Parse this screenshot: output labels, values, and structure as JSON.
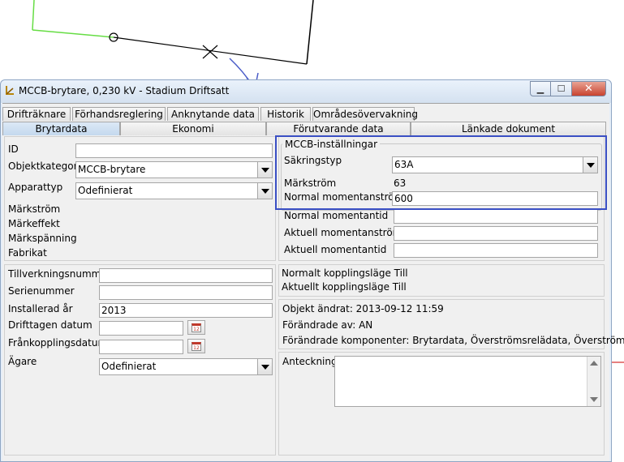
{
  "window": {
    "title": "MCCB-brytare, 0,230 kV - Stadium Driftsatt",
    "minimize_glyph": "▁",
    "maximize_glyph": "☐",
    "close_glyph": "✕"
  },
  "tabs_row1": [
    "Drifträknare",
    "Förhandsreglering",
    "Anknytande data",
    "Historik",
    "Områdesövervakning"
  ],
  "tabs_row2": [
    "Brytardata",
    "Ekonomi",
    "Förutvarande data",
    "Länkade dokument"
  ],
  "left_top": {
    "id_label": "ID",
    "id_value": "",
    "objektkategori_label": "Objektkategori",
    "objektkategori_value": "MCCB-brytare",
    "apparattyp_label": "Apparattyp",
    "apparattyp_value": "Odefinierat",
    "markstrom_label": "Märkström",
    "markeffekt_label": "Märkeffekt",
    "markspanning_label": "Märkspänning",
    "fabrikat_label": "Fabrikat"
  },
  "mccb": {
    "group_title": "MCCB-inställningar",
    "sakringstyp_label": "Säkringstyp",
    "sakringstyp_value": "63A",
    "markstrom_label": "Märkström",
    "markstrom_value": "63",
    "normal_momentanstrom_label": "Normal momentanström",
    "normal_momentanstrom_value": "600",
    "normal_momentantid_label": "Normal momentantid",
    "aktuell_momentanstrom_label": "Aktuell momentanström",
    "aktuell_momentantid_label": "Aktuell momentantid"
  },
  "left_bottom": {
    "tillverkningsnummer_label": "Tillverkningsnummer",
    "serienummer_label": "Serienummer",
    "installerad_label": "Installerad år",
    "installerad_value": "2013",
    "drifttagen_label": "Drifttagen datum",
    "frankopplingsdatum_label": "Frånkopplingsdatum",
    "agare_label": "Ägare",
    "agare_value": "Odefinierat",
    "calendar_glyph": "12"
  },
  "switching": {
    "normalt_label": "Normalt kopplingsläge Till",
    "aktuellt_label": "Aktuellt kopplingsläge Till"
  },
  "changes": {
    "objekt_andrat": "Objekt ändrat: 2013-09-12 11:59",
    "forandrade_av": "Förändrade av: AN",
    "forandrade_komponenter": "Förändrade komponenter: Brytardata, Överströmsrelädata, Överström..."
  },
  "note": {
    "label": "Anteckning"
  },
  "colors": {
    "highlight": "#3a4fc4",
    "green_line": "#66dd44",
    "annotation_arrow": "#4a5cc8"
  }
}
